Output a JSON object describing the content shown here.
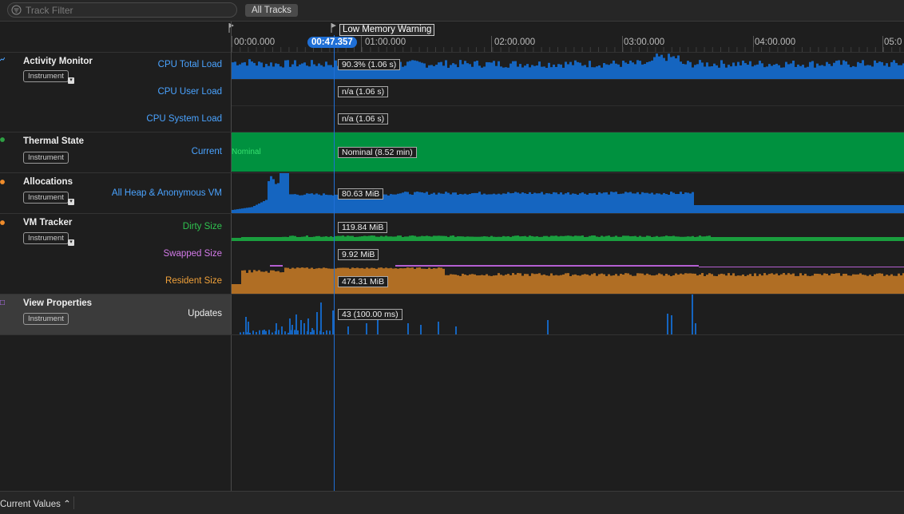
{
  "search": {
    "placeholder": "Track Filter"
  },
  "toolbar": {
    "all_tracks": "All Tracks"
  },
  "timeline": {
    "ticks": [
      "00:00.000",
      "01:00.000",
      "02:00.000",
      "03:00.000",
      "04:00.000",
      "05:0"
    ],
    "playhead": "00:47.357",
    "marker": "Low Memory Warning"
  },
  "tracks": [
    {
      "name": "Activity Monitor",
      "badge": "Instrument",
      "rows": [
        {
          "label": "CPU Total Load",
          "value": "90.3% (1.06 s)"
        },
        {
          "label": "CPU User Load",
          "value": "n/a (1.06 s)"
        },
        {
          "label": "CPU System Load",
          "value": "n/a (1.06 s)"
        }
      ]
    },
    {
      "name": "Thermal State",
      "badge": "Instrument",
      "rows": [
        {
          "label": "Current",
          "value": "Nominal (8.52 min)",
          "band_text": "Nominal"
        }
      ]
    },
    {
      "name": "Allocations",
      "badge": "Instrument",
      "rows": [
        {
          "label": "All Heap & Anonymous VM",
          "value": "80.63 MiB"
        }
      ]
    },
    {
      "name": "VM Tracker",
      "badge": "Instrument",
      "rows": [
        {
          "label": "Dirty Size",
          "value": "119.84 MiB"
        },
        {
          "label": "Swapped Size",
          "value": "9.92 MiB"
        },
        {
          "label": "Resident Size",
          "value": "474.31 MiB"
        }
      ]
    },
    {
      "name": "View Properties",
      "badge": "Instrument",
      "rows": [
        {
          "label": "Updates",
          "value": "43 (100.00 ms)"
        }
      ]
    }
  ],
  "bottom": {
    "selector": "Current Values"
  },
  "colors": {
    "cpu": "#1565c0",
    "thermal": "#00913f",
    "alloc": "#1565c0",
    "dirty": "#1a9e3e",
    "swapped": "#b45fd1",
    "resident": "#b06e24",
    "updates": "#1565c0",
    "playhead": "#1f6fd6"
  }
}
